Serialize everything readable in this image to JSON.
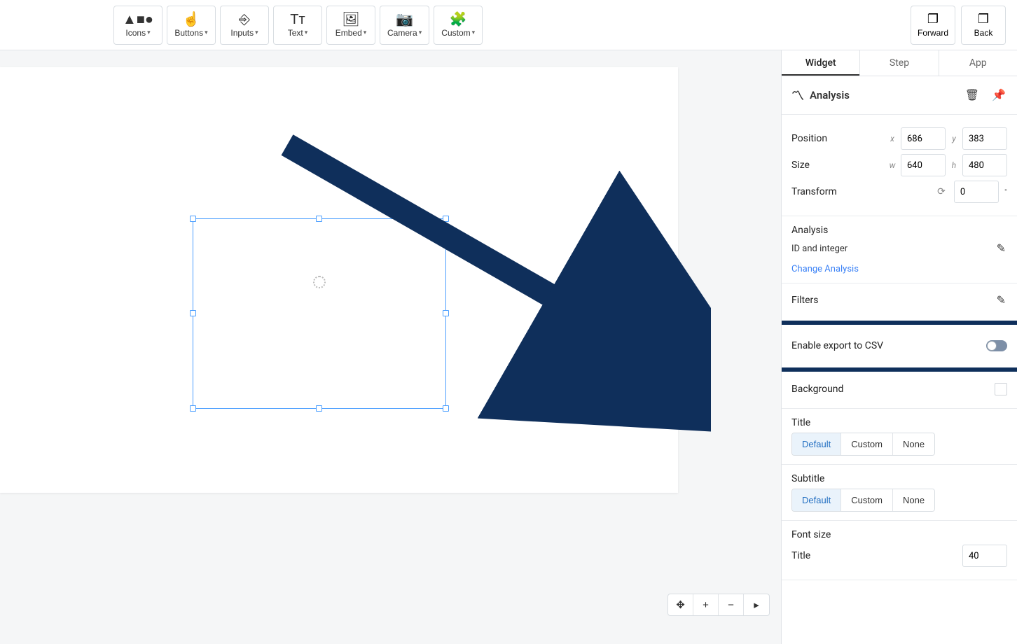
{
  "toolbar": {
    "items": [
      "Icons",
      "Buttons",
      "Inputs",
      "Text",
      "Embed",
      "Camera",
      "Custom"
    ]
  },
  "nav": {
    "forward": "Forward",
    "back": "Back"
  },
  "tabs": {
    "widget": "Widget",
    "step": "Step",
    "app": "App"
  },
  "inspector": {
    "header": "Analysis",
    "position_label": "Position",
    "x_label": "x",
    "x_value": "686",
    "y_label": "y",
    "y_value": "383",
    "size_label": "Size",
    "w_label": "w",
    "w_value": "640",
    "h_label": "h",
    "h_value": "480",
    "transform_label": "Transform",
    "transform_value": "0",
    "analysis_section": "Analysis",
    "analysis_subtext": "ID and integer",
    "change_analysis": "Change Analysis",
    "filters_label": "Filters",
    "export_csv_label": "Enable export to CSV",
    "background_label": "Background",
    "title_label": "Title",
    "subtitle_label": "Subtitle",
    "seg_default": "Default",
    "seg_custom": "Custom",
    "seg_none": "None",
    "fontsize_label": "Font size",
    "fontsize_title": "Title",
    "fontsize_value": "40"
  }
}
